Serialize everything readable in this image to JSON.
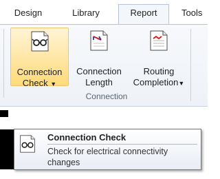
{
  "tabs": [
    {
      "label": "Design",
      "active": false
    },
    {
      "label": "Library",
      "active": false
    },
    {
      "label": "Report",
      "active": true
    },
    {
      "label": "Tools",
      "active": false
    }
  ],
  "ribbon": {
    "group_label": "Connection",
    "buttons": [
      {
        "line1": "Connection",
        "line2": "Check",
        "has_dropdown": true,
        "selected": true,
        "icon": "glasses-document-icon"
      },
      {
        "line1": "Connection",
        "line2": "Length",
        "has_dropdown": false,
        "selected": false,
        "icon": "ruler-document-icon"
      },
      {
        "line1": "Routing",
        "line2": "Completion",
        "has_dropdown": true,
        "selected": false,
        "icon": "routing-document-icon"
      }
    ]
  },
  "tooltip": {
    "title": "Connection Check",
    "description": "Check for electrical connectivity changes",
    "icon": "glasses-document-icon"
  },
  "colors": {
    "selected_fill": "#ffe7a8",
    "selected_border": "#f2c46b",
    "ribbon_bg": "#eef2f7"
  }
}
